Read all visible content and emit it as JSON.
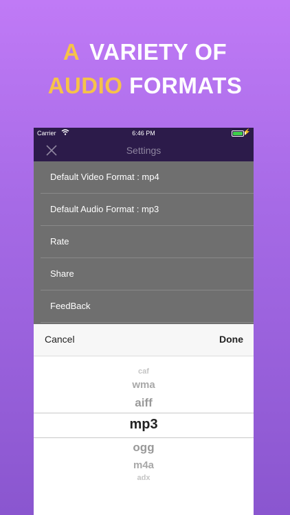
{
  "headline": {
    "line1_highlight": "A",
    "line1_rest": "VARIETY OF",
    "line2_highlight": "AUDIO",
    "line2_rest": "FORMATS"
  },
  "status_bar": {
    "carrier": "Carrier",
    "time": "6:46 PM"
  },
  "nav": {
    "title": "Settings"
  },
  "menu_items": [
    "Default Video Format : mp4",
    "Default Audio Format : mp3",
    "Rate",
    "Share",
    "FeedBack"
  ],
  "picker": {
    "cancel": "Cancel",
    "done": "Done",
    "options": [
      "caf",
      "wma",
      "aiff",
      "mp3",
      "ogg",
      "m4a",
      "adx"
    ],
    "selected": "mp3"
  },
  "colors": {
    "accent": "#f6c24a",
    "nav_bar": "#2c1b4a",
    "battery": "#3ecf4a"
  }
}
